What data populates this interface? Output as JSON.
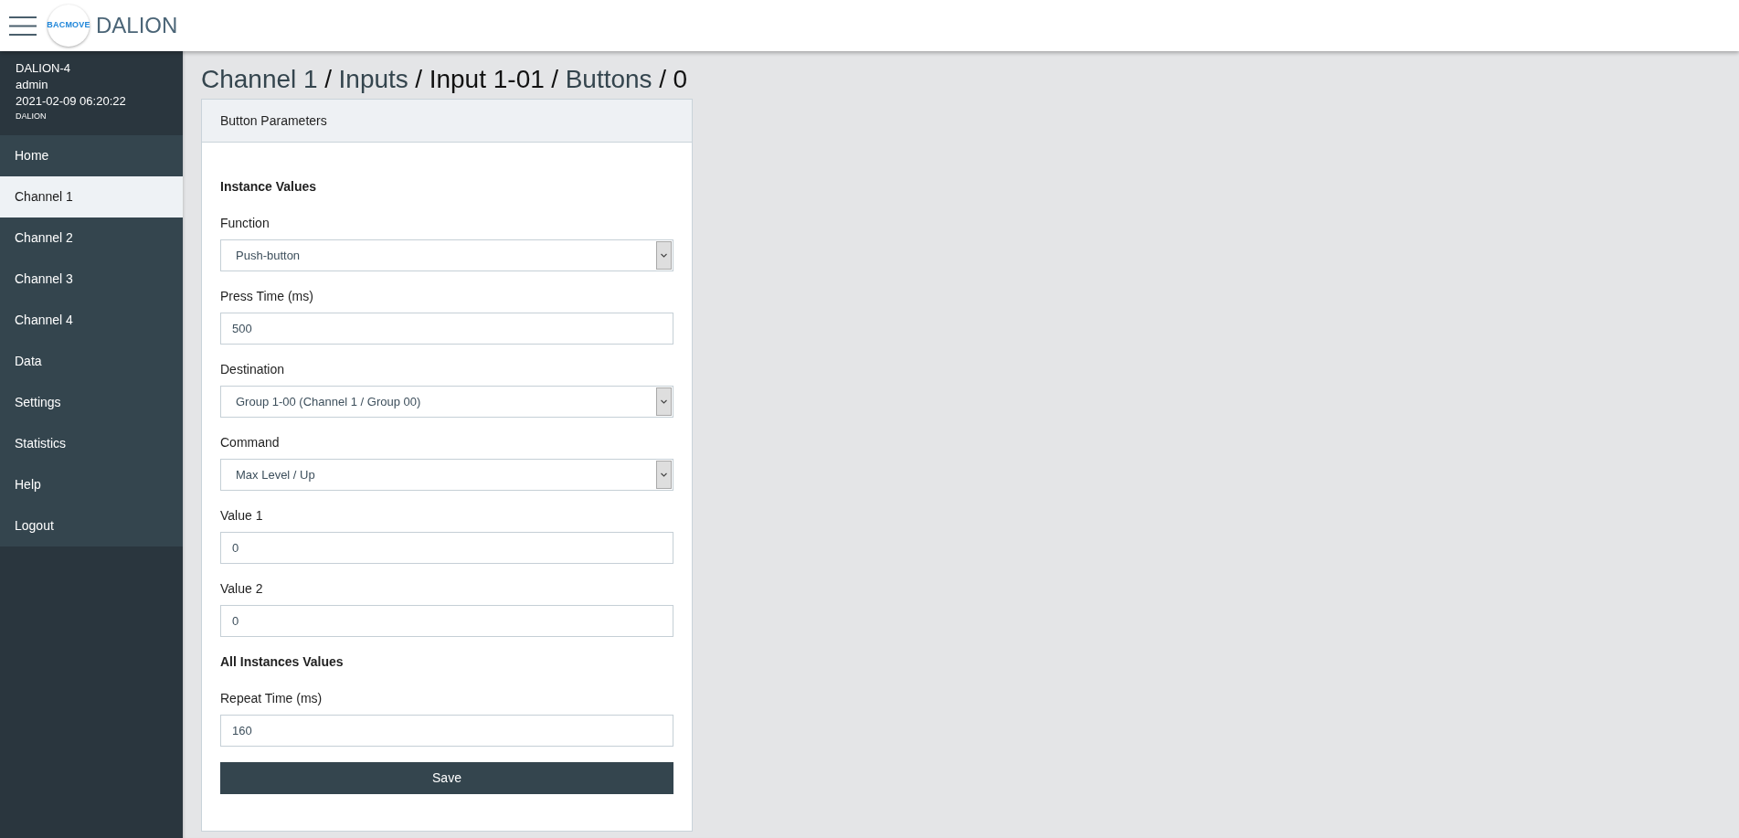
{
  "header": {
    "logo_text": "BACMOVE",
    "brand": "DALION"
  },
  "sidebar": {
    "device": "DALION-4",
    "user": "admin",
    "datetime": "2021-02-09 06:20:22",
    "product": "DALION",
    "items": [
      {
        "label": "Home",
        "selected": false
      },
      {
        "label": "Channel 1",
        "selected": true
      },
      {
        "label": "Channel 2",
        "selected": false
      },
      {
        "label": "Channel 3",
        "selected": false
      },
      {
        "label": "Channel 4",
        "selected": false
      },
      {
        "label": "Data",
        "selected": false
      },
      {
        "label": "Settings",
        "selected": false
      },
      {
        "label": "Statistics",
        "selected": false
      },
      {
        "label": "Help",
        "selected": false
      },
      {
        "label": "Logout",
        "selected": false
      }
    ]
  },
  "breadcrumb": [
    {
      "text": "Channel 1",
      "kind": "link"
    },
    {
      "text": "/",
      "kind": "separator"
    },
    {
      "text": "Inputs",
      "kind": "link"
    },
    {
      "text": "/",
      "kind": "separator"
    },
    {
      "text": "Input 1-01",
      "kind": "current"
    },
    {
      "text": "/",
      "kind": "separator"
    },
    {
      "text": "Buttons",
      "kind": "link"
    },
    {
      "text": "/",
      "kind": "separator"
    },
    {
      "text": "0",
      "kind": "current"
    }
  ],
  "card": {
    "title": "Button Parameters",
    "sections": [
      {
        "heading": "Instance Values",
        "fields": [
          {
            "label": "Function",
            "kind": "select",
            "value": "Push-button"
          },
          {
            "label": "Press Time (ms)",
            "kind": "input",
            "value": "500"
          },
          {
            "label": "Destination",
            "kind": "select",
            "value": "Group 1-00 (Channel 1 / Group 00)"
          },
          {
            "label": "Command",
            "kind": "select",
            "value": "Max Level / Up"
          },
          {
            "label": "Value 1",
            "kind": "input",
            "value": "0"
          },
          {
            "label": "Value 2",
            "kind": "input",
            "value": "0"
          }
        ]
      },
      {
        "heading": "All Instances Values",
        "fields": [
          {
            "label": "Repeat Time (ms)",
            "kind": "input",
            "value": "160"
          }
        ]
      }
    ],
    "save_button": "Save"
  }
}
